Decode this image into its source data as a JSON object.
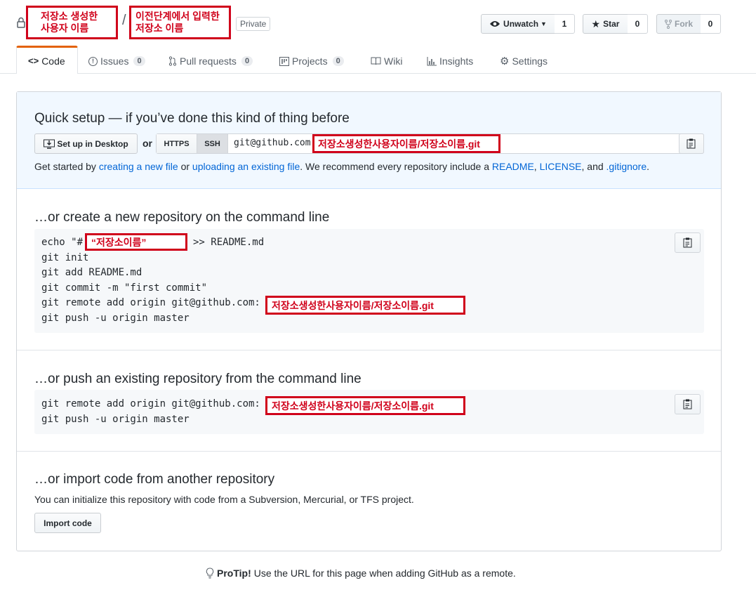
{
  "header": {
    "owner_annotation_line1": "저장소 생성한",
    "owner_annotation_line2": "사용자 이름",
    "separator": "/",
    "repo_annotation_line1": "이전단계에서 입력한",
    "repo_annotation_line2": "저장소 이름",
    "visibility_badge": "Private",
    "unwatch_label": "Unwatch",
    "unwatch_count": "1",
    "star_label": "Star",
    "star_count": "0",
    "fork_label": "Fork",
    "fork_count": "0"
  },
  "tabs": {
    "code": "Code",
    "issues": "Issues",
    "issues_count": "0",
    "pull_requests": "Pull requests",
    "pull_requests_count": "0",
    "projects": "Projects",
    "projects_count": "0",
    "wiki": "Wiki",
    "insights": "Insights",
    "settings": "Settings"
  },
  "quick_setup": {
    "title": "Quick setup — if you’ve done this kind of thing before",
    "desktop_button": "Set up in Desktop",
    "or": "or",
    "https_tab": "HTTPS",
    "ssh_tab": "SSH",
    "url_prefix": "git@github.com:",
    "url_annotation": "저장소생성한사용자이름/저장소이름.git",
    "desc_prefix": "Get started by",
    "link_create": "creating a new file",
    "desc_or": "or",
    "link_upload": "uploading an existing file",
    "desc_middle": ". We recommend every repository include a",
    "link_readme": "README",
    "comma": ",",
    "link_license": "LICENSE",
    "desc_and": ", and",
    "link_gitignore": ".gitignore",
    "period": "."
  },
  "create_section": {
    "title": "…or create a new repository on the command line",
    "line1_prefix": "echo \"#",
    "line1_annotation": "“저장소이름”",
    "line1_suffix": ">> README.md",
    "line2": "git init",
    "line3": "git add README.md",
    "line4": "git commit -m \"first commit\"",
    "line5_prefix": "git remote add origin git@github.com:",
    "line5_annotation": "저장소생성한사용자이름/저장소이름.git",
    "line6": "git push -u origin master"
  },
  "push_section": {
    "title": "…or push an existing repository from the command line",
    "line1_prefix": "git remote add origin git@github.com:",
    "line1_annotation": "저장소생성한사용자이름/저장소이름.git",
    "line2": "git push -u origin master"
  },
  "import_section": {
    "title": "…or import code from another repository",
    "description": "You can initialize this repository with code from a Subversion, Mercurial, or TFS project.",
    "button": "Import code"
  },
  "protip": {
    "label": "ProTip!",
    "text": "Use the URL for this page when adding GitHub as a remote."
  },
  "colors": {
    "annotation_red": "#d0021b",
    "link_blue": "#0366d6",
    "tab_accent": "#e36209",
    "quick_setup_bg": "#f1f8ff"
  }
}
